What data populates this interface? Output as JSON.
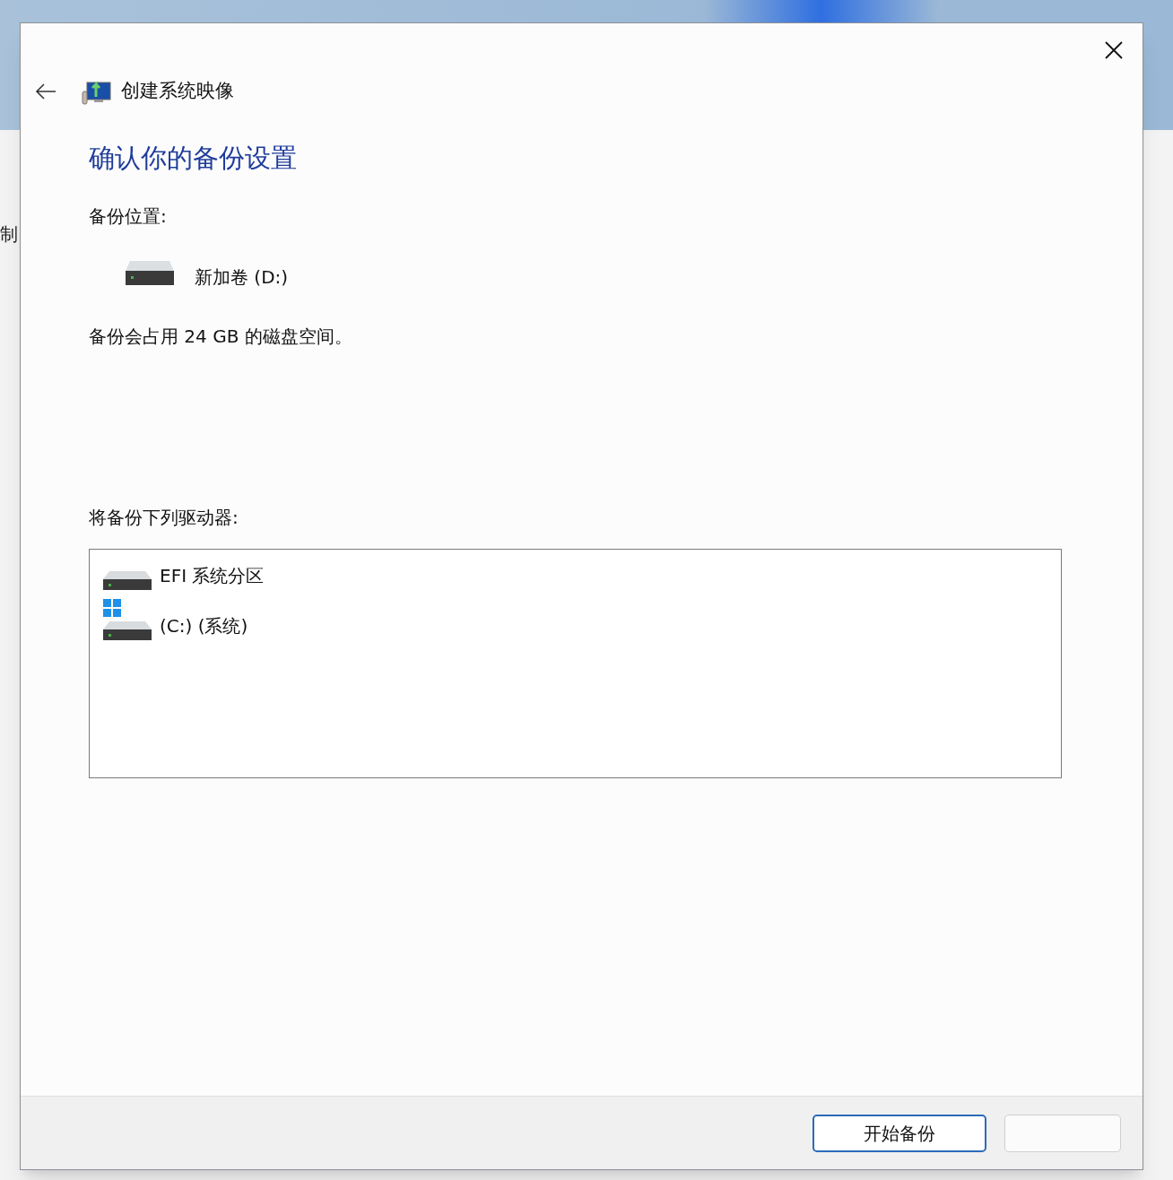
{
  "background": {
    "side_text": "制"
  },
  "window": {
    "title": "创建系统映像"
  },
  "heading": "确认你的备份设置",
  "backup_location": {
    "label": "备份位置:",
    "drive": "新加卷 (D:)"
  },
  "space_note": "备份会占用 24 GB 的磁盘空间。",
  "drives_label": "将备份下列驱动器:",
  "drives": [
    {
      "name": "EFI 系统分区",
      "kind": "partition"
    },
    {
      "name": "(C:) (系统)",
      "kind": "system"
    }
  ],
  "buttons": [
    {
      "label": "开始备份",
      "kind": "primary"
    },
    {
      "kind": "secondary"
    }
  ]
}
